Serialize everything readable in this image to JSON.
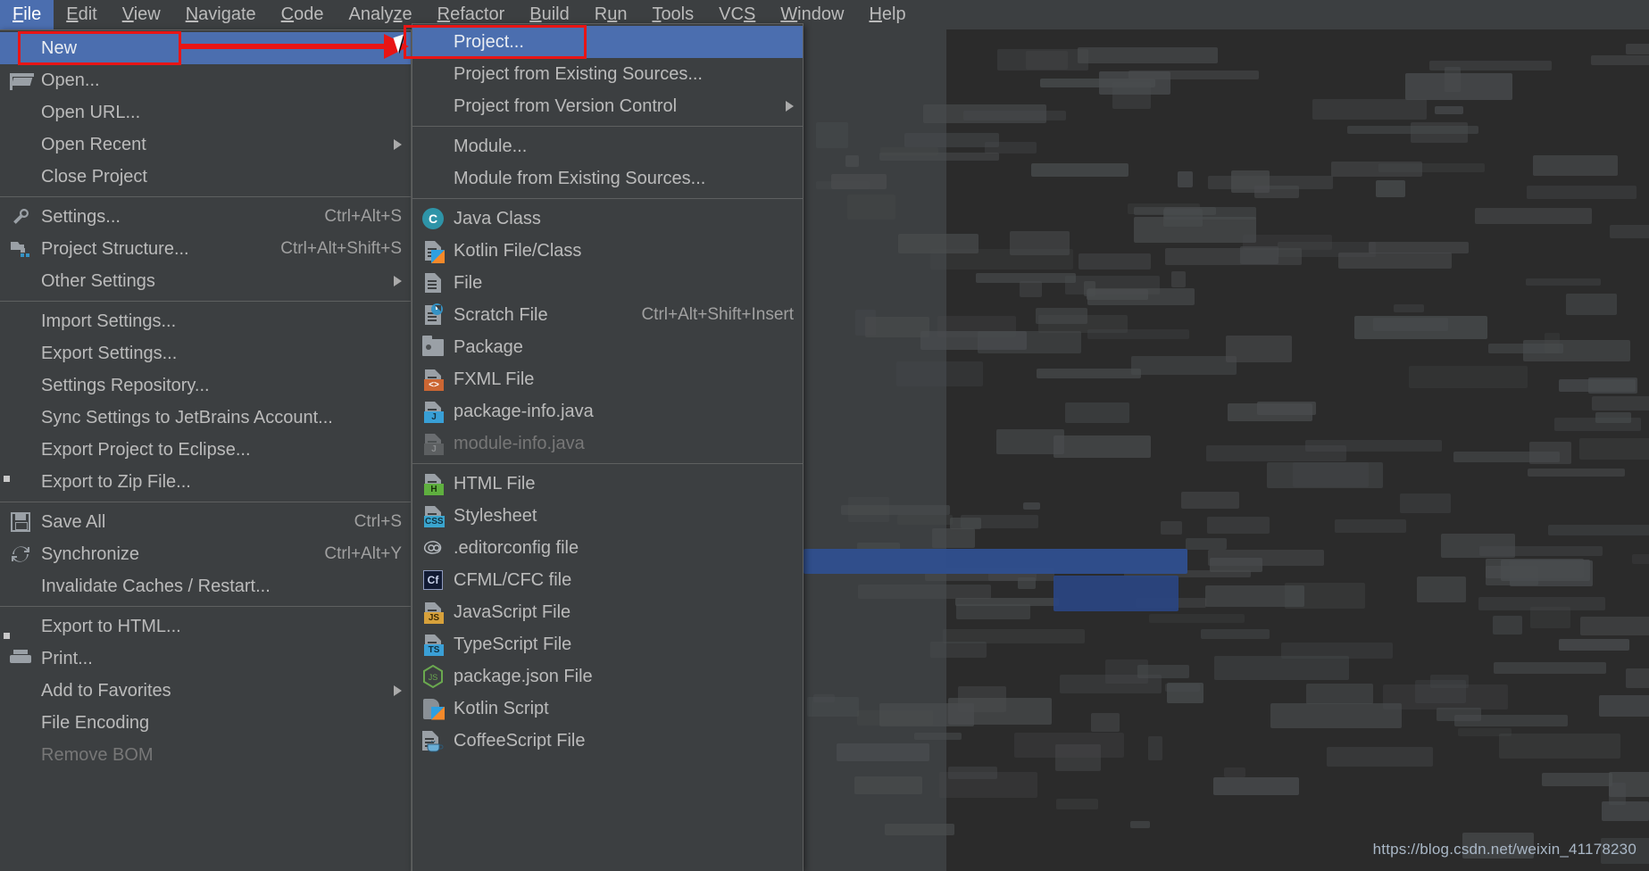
{
  "app": {
    "watermark": "https://blog.csdn.net/weixin_41178230"
  },
  "menubar": {
    "items": [
      {
        "label": "File",
        "mnemonic": "F",
        "active": true
      },
      {
        "label": "Edit",
        "mnemonic": "E",
        "active": false
      },
      {
        "label": "View",
        "mnemonic": "V",
        "active": false
      },
      {
        "label": "Navigate",
        "mnemonic": "N",
        "active": false
      },
      {
        "label": "Code",
        "mnemonic": "C",
        "active": false
      },
      {
        "label": "Analyze",
        "mnemonic": "z",
        "active": false
      },
      {
        "label": "Refactor",
        "mnemonic": "R",
        "active": false
      },
      {
        "label": "Build",
        "mnemonic": "B",
        "active": false
      },
      {
        "label": "Run",
        "mnemonic": "u",
        "active": false
      },
      {
        "label": "Tools",
        "mnemonic": "T",
        "active": false
      },
      {
        "label": "VCS",
        "mnemonic": "S",
        "active": false
      },
      {
        "label": "Window",
        "mnemonic": "W",
        "active": false
      },
      {
        "label": "Help",
        "mnemonic": "H",
        "active": false
      }
    ]
  },
  "file_menu": {
    "items": [
      {
        "label": "New",
        "icon": "none",
        "accel": "",
        "submenu": true,
        "selected": true,
        "disabled": false
      },
      {
        "label": "Open...",
        "icon": "open-folder",
        "accel": "",
        "submenu": false,
        "selected": false,
        "disabled": false
      },
      {
        "label": "Open URL...",
        "icon": "none",
        "accel": "",
        "submenu": false,
        "selected": false,
        "disabled": false
      },
      {
        "label": "Open Recent",
        "icon": "none",
        "accel": "",
        "submenu": true,
        "selected": false,
        "disabled": false
      },
      {
        "label": "Close Project",
        "icon": "none",
        "accel": "",
        "submenu": false,
        "selected": false,
        "disabled": false
      },
      {
        "separator": true
      },
      {
        "label": "Settings...",
        "icon": "wrench",
        "accel": "Ctrl+Alt+S",
        "submenu": false,
        "selected": false,
        "disabled": false
      },
      {
        "label": "Project Structure...",
        "icon": "project",
        "accel": "Ctrl+Alt+Shift+S",
        "submenu": false,
        "selected": false,
        "disabled": false
      },
      {
        "label": "Other Settings",
        "icon": "none",
        "accel": "",
        "submenu": true,
        "selected": false,
        "disabled": false
      },
      {
        "separator": true
      },
      {
        "label": "Import Settings...",
        "icon": "none",
        "accel": "",
        "submenu": false,
        "selected": false,
        "disabled": false
      },
      {
        "label": "Export Settings...",
        "icon": "none",
        "accel": "",
        "submenu": false,
        "selected": false,
        "disabled": false
      },
      {
        "label": "Settings Repository...",
        "icon": "none",
        "accel": "",
        "submenu": false,
        "selected": false,
        "disabled": false
      },
      {
        "label": "Sync Settings to JetBrains Account...",
        "icon": "none",
        "accel": "",
        "submenu": false,
        "selected": false,
        "disabled": false
      },
      {
        "label": "Export Project to Eclipse...",
        "icon": "none",
        "accel": "",
        "submenu": false,
        "selected": false,
        "disabled": false
      },
      {
        "label": "Export to Zip File...",
        "icon": "none",
        "accel": "",
        "submenu": false,
        "selected": false,
        "disabled": false
      },
      {
        "separator": true
      },
      {
        "label": "Save All",
        "icon": "save",
        "accel": "Ctrl+S",
        "submenu": false,
        "selected": false,
        "disabled": false
      },
      {
        "label": "Synchronize",
        "icon": "sync",
        "accel": "Ctrl+Alt+Y",
        "submenu": false,
        "selected": false,
        "disabled": false
      },
      {
        "label": "Invalidate Caches / Restart...",
        "icon": "none",
        "accel": "",
        "submenu": false,
        "selected": false,
        "disabled": false
      },
      {
        "separator": true
      },
      {
        "label": "Export to HTML...",
        "icon": "none",
        "accel": "",
        "submenu": false,
        "selected": false,
        "disabled": false
      },
      {
        "label": "Print...",
        "icon": "printer",
        "accel": "",
        "submenu": false,
        "selected": false,
        "disabled": false
      },
      {
        "label": "Add to Favorites",
        "icon": "none",
        "accel": "",
        "submenu": true,
        "selected": false,
        "disabled": false
      },
      {
        "label": "File Encoding",
        "icon": "none",
        "accel": "",
        "submenu": false,
        "selected": false,
        "disabled": false
      },
      {
        "label": "Remove BOM",
        "icon": "none",
        "accel": "",
        "submenu": false,
        "selected": false,
        "disabled": true
      }
    ]
  },
  "new_submenu": {
    "items": [
      {
        "label": "Project...",
        "icon": "none",
        "accel": "",
        "submenu": false,
        "selected": true,
        "disabled": false
      },
      {
        "label": "Project from Existing Sources...",
        "icon": "none",
        "accel": "",
        "submenu": false,
        "selected": false,
        "disabled": false
      },
      {
        "label": "Project from Version Control",
        "icon": "none",
        "accel": "",
        "submenu": true,
        "selected": false,
        "disabled": false
      },
      {
        "separator": true
      },
      {
        "label": "Module...",
        "icon": "none",
        "accel": "",
        "submenu": false,
        "selected": false,
        "disabled": false
      },
      {
        "label": "Module from Existing Sources...",
        "icon": "none",
        "accel": "",
        "submenu": false,
        "selected": false,
        "disabled": false
      },
      {
        "separator": true
      },
      {
        "label": "Java Class",
        "icon": "java-class",
        "accel": "",
        "submenu": false,
        "selected": false,
        "disabled": false
      },
      {
        "label": "Kotlin File/Class",
        "icon": "kotlin-file",
        "accel": "",
        "submenu": false,
        "selected": false,
        "disabled": false
      },
      {
        "label": "File",
        "icon": "file",
        "accel": "",
        "submenu": false,
        "selected": false,
        "disabled": false
      },
      {
        "label": "Scratch File",
        "icon": "scratch",
        "accel": "Ctrl+Alt+Shift+Insert",
        "submenu": false,
        "selected": false,
        "disabled": false
      },
      {
        "label": "Package",
        "icon": "package",
        "accel": "",
        "submenu": false,
        "selected": false,
        "disabled": false
      },
      {
        "label": "FXML File",
        "icon": "fxml",
        "accel": "",
        "submenu": false,
        "selected": false,
        "disabled": false
      },
      {
        "label": "package-info.java",
        "icon": "java-file",
        "accel": "",
        "submenu": false,
        "selected": false,
        "disabled": false
      },
      {
        "label": "module-info.java",
        "icon": "java-dim",
        "accel": "",
        "submenu": false,
        "selected": false,
        "disabled": true
      },
      {
        "separator": true
      },
      {
        "label": "HTML File",
        "icon": "html",
        "accel": "",
        "submenu": false,
        "selected": false,
        "disabled": false
      },
      {
        "label": "Stylesheet",
        "icon": "css",
        "accel": "",
        "submenu": false,
        "selected": false,
        "disabled": false
      },
      {
        "label": ".editorconfig file",
        "icon": "editorconfig",
        "accel": "",
        "submenu": false,
        "selected": false,
        "disabled": false
      },
      {
        "label": "CFML/CFC file",
        "icon": "cfml",
        "accel": "",
        "submenu": false,
        "selected": false,
        "disabled": false
      },
      {
        "label": "JavaScript File",
        "icon": "js",
        "accel": "",
        "submenu": false,
        "selected": false,
        "disabled": false
      },
      {
        "label": "TypeScript File",
        "icon": "ts",
        "accel": "",
        "submenu": false,
        "selected": false,
        "disabled": false
      },
      {
        "label": "package.json File",
        "icon": "node",
        "accel": "",
        "submenu": false,
        "selected": false,
        "disabled": false
      },
      {
        "label": "Kotlin Script",
        "icon": "kotlin-script",
        "accel": "",
        "submenu": false,
        "selected": false,
        "disabled": false
      },
      {
        "label": "CoffeeScript File",
        "icon": "coffee",
        "accel": "",
        "submenu": false,
        "selected": false,
        "disabled": false
      }
    ]
  },
  "annotations": {
    "highlight_new": "New",
    "highlight_project": "Project...",
    "accent_color": "#e81515",
    "selection_color": "#4b6eaf"
  }
}
